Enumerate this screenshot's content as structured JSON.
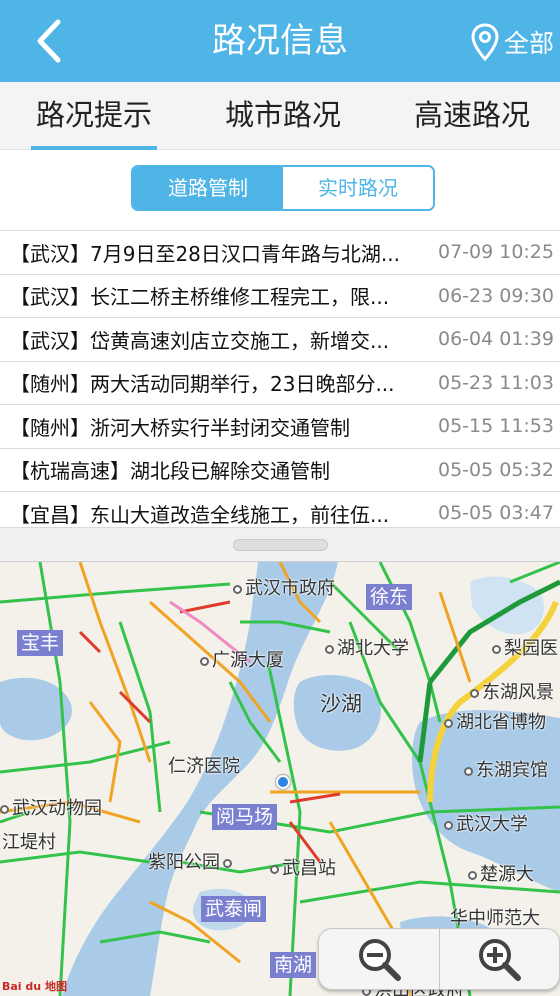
{
  "header": {
    "title": "路况信息",
    "region_label": "全部"
  },
  "tabs": [
    {
      "label": "路况提示",
      "active": true
    },
    {
      "label": "城市路况",
      "active": false
    },
    {
      "label": "高速路况",
      "active": false
    }
  ],
  "segments": [
    {
      "label": "道路管制",
      "selected": true
    },
    {
      "label": "实时路况",
      "selected": false
    }
  ],
  "notices": [
    {
      "title": "【武汉】7月9日至28日汉口青年路与北湖...",
      "time": "07-09 10:25"
    },
    {
      "title": "【武汉】长江二桥主桥维修工程完工，限...",
      "time": "06-23 09:30"
    },
    {
      "title": "【武汉】岱黄高速刘店立交施工，新增交...",
      "time": "06-04 01:39"
    },
    {
      "title": "【随州】两大活动同期举行，23日晚部分...",
      "time": "05-23 11:03"
    },
    {
      "title": "【随州】浙河大桥实行半封闭交通管制",
      "time": "05-15 11:53"
    },
    {
      "title": "【杭瑞高速】湖北段已解除交通管制",
      "time": "05-05 05:32"
    },
    {
      "title": "【宜昌】东山大道改造全线施工，前往伍...",
      "time": "05-05 03:47"
    }
  ],
  "map": {
    "places": [
      "武汉市政府",
      "湖北大学",
      "广源大厦",
      "梨园医",
      "东湖风景",
      "湖北省博物",
      "仁济医院",
      "东湖宾馆",
      "武汉动物园",
      "江堤村",
      "武汉大学",
      "紫阳公园",
      "武昌站",
      "楚源大",
      "华中师范大",
      "洪山区政府"
    ],
    "districts": [
      "徐东",
      "宝丰",
      "阅马场",
      "武泰闸",
      "南湖"
    ],
    "lakes": [
      "沙湖"
    ],
    "logo_text": "Bai du 地图"
  },
  "colors": {
    "accent": "#4fb4e6",
    "road_clear": "#33c24a",
    "road_slow": "#f0a422",
    "road_jam": "#e03a2a",
    "water": "#a9cbe8"
  }
}
